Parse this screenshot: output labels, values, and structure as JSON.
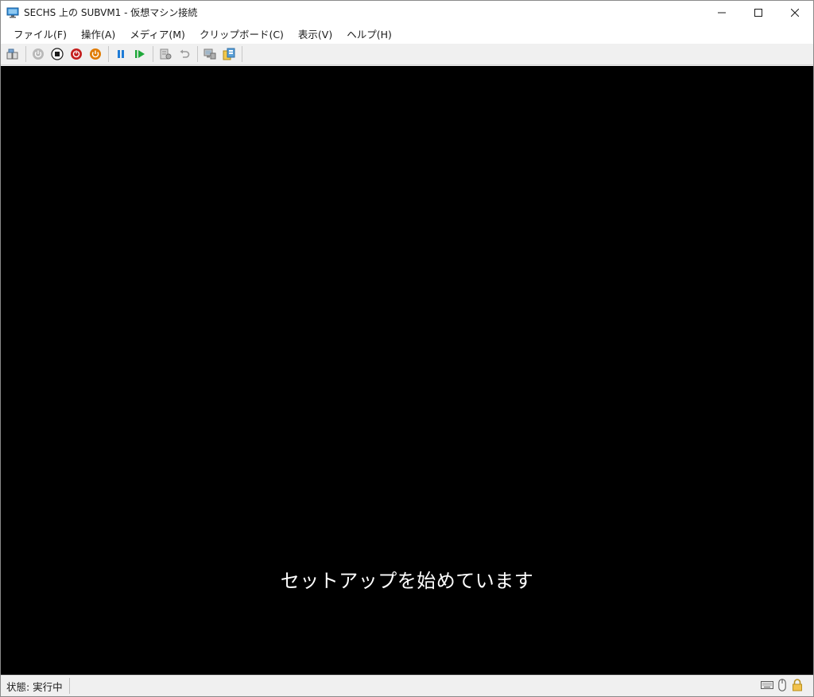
{
  "window": {
    "title": "SECHS 上の SUBVM1 - 仮想マシン接続"
  },
  "caption": {
    "minimize_icon": "minimize-icon",
    "maximize_icon": "maximize-icon",
    "close_icon": "close-icon"
  },
  "menu": {
    "items": [
      {
        "label": "ファイル(F)"
      },
      {
        "label": "操作(A)"
      },
      {
        "label": "メディア(M)"
      },
      {
        "label": "クリップボード(C)"
      },
      {
        "label": "表示(V)"
      },
      {
        "label": "ヘルプ(H)"
      }
    ]
  },
  "toolbar": {
    "buttons": [
      {
        "icon": "ctrl-alt-del-icon"
      },
      {
        "icon": "start-icon",
        "color": "#9a9a9a"
      },
      {
        "icon": "turn-off-icon",
        "color": "#1a1a1a"
      },
      {
        "icon": "shut-down-icon",
        "color": "#c41e1e"
      },
      {
        "icon": "save-icon",
        "color": "#e07b00"
      },
      {
        "icon": "pause-icon",
        "color": "#1e7bd6"
      },
      {
        "icon": "resume-icon",
        "color": "#1fa83a"
      },
      {
        "icon": "checkpoint-icon"
      },
      {
        "icon": "revert-icon"
      },
      {
        "icon": "enhanced-session-icon"
      },
      {
        "icon": "share-icon"
      }
    ]
  },
  "vm": {
    "message": "セットアップを始めています",
    "background": "#000000"
  },
  "status": {
    "text": "状態: 実行中",
    "icons": [
      "keyboard-icon",
      "mouse-icon",
      "lock-icon"
    ]
  }
}
